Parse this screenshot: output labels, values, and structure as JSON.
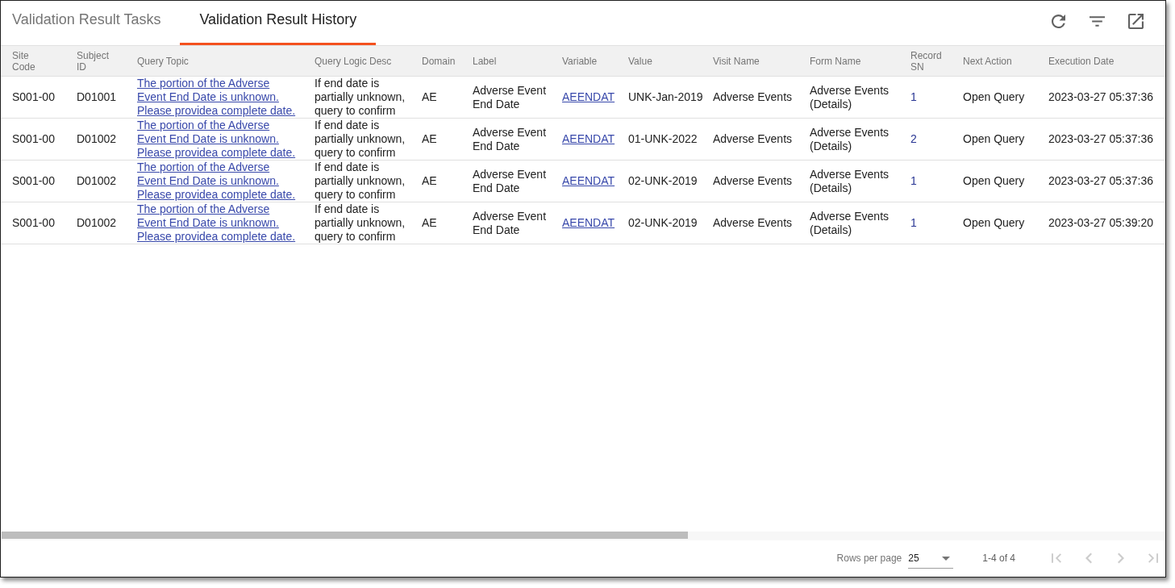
{
  "tabs": [
    {
      "label": "Validation Result Tasks",
      "selected": false
    },
    {
      "label": "Validation Result History",
      "selected": true
    }
  ],
  "table": {
    "columns": [
      {
        "label": "Site Code",
        "kind": "text"
      },
      {
        "label": "Subject ID",
        "kind": "text"
      },
      {
        "label": "Query Topic",
        "kind": "link"
      },
      {
        "label": "Query Logic Desc",
        "kind": "text"
      },
      {
        "label": "Domain",
        "kind": "text"
      },
      {
        "label": "Label",
        "kind": "text"
      },
      {
        "label": "Variable",
        "kind": "link"
      },
      {
        "label": "Value",
        "kind": "text"
      },
      {
        "label": "Visit Name",
        "kind": "text"
      },
      {
        "label": "Form Name",
        "kind": "text"
      },
      {
        "label": "Record SN",
        "kind": "ref"
      },
      {
        "label": "Next Action",
        "kind": "text"
      },
      {
        "label": "Execution Date",
        "kind": "text"
      }
    ],
    "rows": [
      {
        "cells": [
          "S001-00",
          "D01001",
          "The portion of the Adverse Event End Date is unknown. Please providea complete date.",
          "If end date is partially unknown, query to confirm",
          "AE",
          "Adverse Event End Date",
          "AEENDAT",
          "UNK-Jan-2019",
          "Adverse Events",
          "Adverse Events (Details)",
          "1",
          "Open Query",
          "2023-03-27 05:37:36"
        ]
      },
      {
        "cells": [
          "S001-00",
          "D01002",
          "The portion of the Adverse Event End Date is unknown. Please providea complete date.",
          "If end date is partially unknown, query to confirm",
          "AE",
          "Adverse Event End Date",
          "AEENDAT",
          "01-UNK-2022",
          "Adverse Events",
          "Adverse Events (Details)",
          "2",
          "Open Query",
          "2023-03-27 05:37:36"
        ]
      },
      {
        "cells": [
          "S001-00",
          "D01002",
          "The portion of the Adverse Event End Date is unknown. Please providea complete date.",
          "If end date is partially unknown, query to confirm",
          "AE",
          "Adverse Event End Date",
          "AEENDAT",
          "02-UNK-2019",
          "Adverse Events",
          "Adverse Events (Details)",
          "1",
          "Open Query",
          "2023-03-27 05:37:36"
        ]
      },
      {
        "cells": [
          "S001-00",
          "D01002",
          "The portion of the Adverse Event End Date is unknown. Please providea complete date.",
          "If end date is partially unknown, query to confirm",
          "AE",
          "Adverse Event End Date",
          "AEENDAT",
          "02-UNK-2019",
          "Adverse Events",
          "Adverse Events (Details)",
          "1",
          "Open Query",
          "2023-03-27 05:39:20"
        ]
      }
    ]
  },
  "footer": {
    "rows_per_page_label": "Rows per page",
    "rows_per_page": "25",
    "range": "1-4 of 4",
    "pagination": [
      {
        "kind": "first",
        "disabled": true
      },
      {
        "kind": "previous",
        "disabled": true
      },
      {
        "kind": "next",
        "disabled": true
      },
      {
        "kind": "last",
        "disabled": true
      }
    ]
  }
}
